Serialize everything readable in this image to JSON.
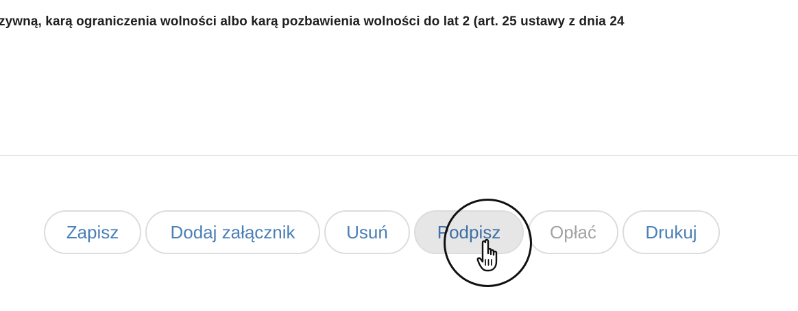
{
  "document": {
    "legal_text": "zywną, karą ograniczenia wolności albo karą pozbawienia wolności do lat 2 (art. 25 ustawy z dnia 24"
  },
  "toolbar": {
    "buttons": [
      {
        "label": "Zapisz",
        "state": "enabled"
      },
      {
        "label": "Dodaj załącznik",
        "state": "enabled"
      },
      {
        "label": "Usuń",
        "state": "enabled"
      },
      {
        "label": "Podpisz",
        "state": "hover"
      },
      {
        "label": "Opłać",
        "state": "disabled"
      },
      {
        "label": "Drukuj",
        "state": "enabled"
      }
    ]
  },
  "cursor": {
    "icon": "hand-pointer-icon"
  },
  "colors": {
    "button_text": "#4a7fb8",
    "button_border": "#dcdcdc",
    "button_hover_bg": "#e6e6e6",
    "disabled_text": "#a3a3a3",
    "legal_text": "#1f1f1f"
  }
}
